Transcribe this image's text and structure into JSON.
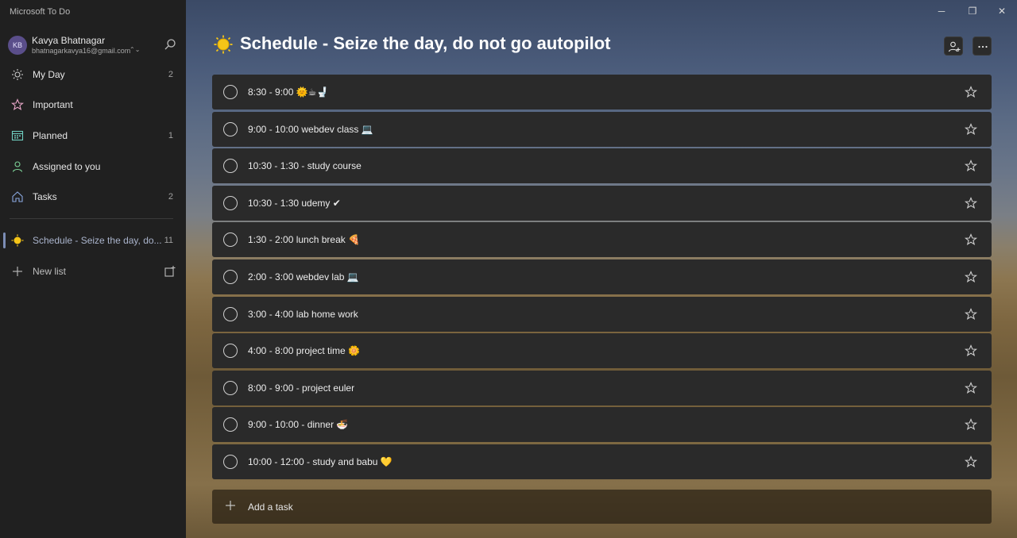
{
  "app": {
    "title": "Microsoft To Do"
  },
  "account": {
    "initials": "KB",
    "name": "Kavya Bhatnagar",
    "email": "bhatnagarkavya16@gmail.com"
  },
  "nav": [
    {
      "label": "My Day",
      "count": "2",
      "icon": "sun-icon"
    },
    {
      "label": "Important",
      "count": "",
      "icon": "star-icon"
    },
    {
      "label": "Planned",
      "count": "1",
      "icon": "calendar-icon"
    },
    {
      "label": "Assigned to you",
      "count": "",
      "icon": "person-icon"
    },
    {
      "label": "Tasks",
      "count": "2",
      "icon": "home-icon"
    }
  ],
  "lists": [
    {
      "label": "Schedule - Seize the day, do...",
      "count": "11",
      "icon": "sun-emoji-icon"
    }
  ],
  "new_list": {
    "label": "New list"
  },
  "main": {
    "title": "Schedule - Seize the day, do not go autopilot",
    "tasks": [
      {
        "label": "8:30 - 9:00 🌞☕🚽"
      },
      {
        "label": "9:00 - 10:00 webdev class 💻"
      },
      {
        "label": "10:30 - 1:30 - study course"
      },
      {
        "label": "10:30 - 1:30 udemy ✔"
      },
      {
        "label": "1:30 - 2:00 lunch break 🍕"
      },
      {
        "label": "2:00 - 3:00 webdev lab 💻"
      },
      {
        "label": "3:00 - 4:00 lab home work"
      },
      {
        "label": "4:00 - 8:00 project time 🌼"
      },
      {
        "label": "8:00 - 9:00 - project euler"
      },
      {
        "label": "9:00 - 10:00 - dinner 🍜"
      },
      {
        "label": "10:00 - 12:00 - study and babu 💛"
      }
    ],
    "add_task": {
      "label": "Add a task"
    }
  },
  "colors": {
    "sidebar_bg": "#202020",
    "task_bg": "#2a2a2a",
    "accent": "#7c8db5",
    "sun": "#f5c518"
  }
}
